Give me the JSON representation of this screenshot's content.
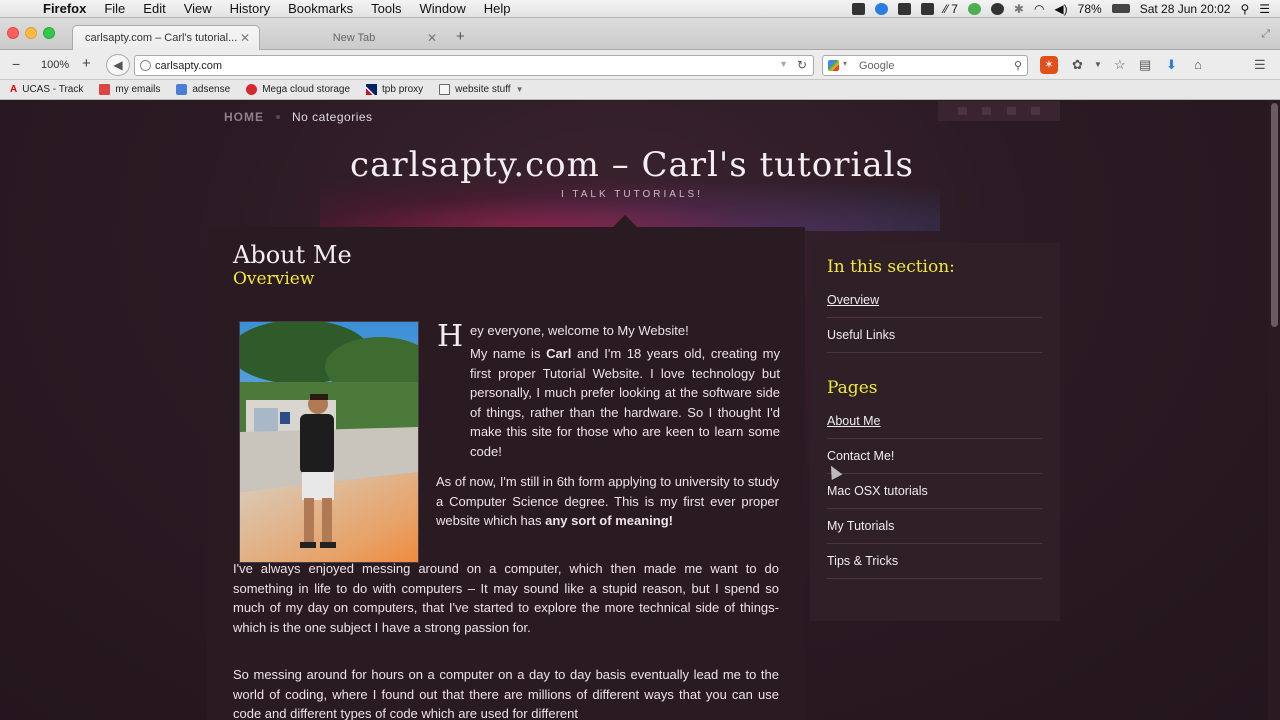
{
  "menubar": {
    "app": "Firefox",
    "items": [
      "File",
      "Edit",
      "View",
      "History",
      "Bookmarks",
      "Tools",
      "Window",
      "Help"
    ],
    "status_num": "7",
    "battery": "78%",
    "datetime": "Sat 28 Jun  20:02"
  },
  "browser": {
    "tabs": [
      {
        "label": "carlsapty.com – Carl's tutorial..."
      },
      {
        "label": "New Tab"
      }
    ],
    "zoom": "100%",
    "url": "carlsapty.com",
    "search_placeholder": "Google"
  },
  "bookmarks": [
    {
      "label": "UCAS - Track",
      "icon": "ucas-icon"
    },
    {
      "label": "my emails",
      "icon": "gmail-icon"
    },
    {
      "label": "adsense",
      "icon": "google-icon"
    },
    {
      "label": "Mega cloud storage",
      "icon": "mega-icon"
    },
    {
      "label": "tpb proxy",
      "icon": "flag-icon"
    },
    {
      "label": "website stuff",
      "icon": "folder-icon"
    }
  ],
  "site": {
    "nav_home": "HOME",
    "nav_categories": "No categories",
    "title": "carlsapty.com – Carl's tutorials",
    "tagline": "I TALK TUTORIALS!"
  },
  "article": {
    "heading": "About Me",
    "subheading": "Overview",
    "dropcap": "H",
    "p1": "ey everyone, welcome to My Website!",
    "p2_pre": "My name is ",
    "p2_bold": "Carl",
    "p2_post": " and I'm 18 years old, creating my first proper Tutorial Website. I love technology but personally, I much prefer looking at the software side of things, rather than the hardware. So I thought I'd make this site for those who are keen to learn some code!",
    "p3_pre": "As of now, I'm still in 6th form applying to university to study a Computer Science degree. This is my first ever proper website which has ",
    "p3_bold": "any sort of meaning!",
    "p4": "I've always enjoyed messing around on a computer, which then made me want to do something in life to do with computers – It may sound like a stupid reason, but I spend so much of my day on computers, that I've started to explore the more technical side of things- which is the one subject I have a strong passion for.",
    "p5": "So messing around for hours on a computer on a day to day basis eventually lead me to the world of coding, where I found out that there are millions of different ways that you can use code and different types of code which are used for different"
  },
  "sidebar": {
    "section_heading": "In this section:",
    "section_links": [
      "Overview",
      "Useful Links"
    ],
    "pages_heading": "Pages",
    "pages_links": [
      "About Me",
      "Contact Me!",
      "Mac OSX tutorials",
      "My Tutorials",
      "Tips & Tricks"
    ]
  },
  "colors": {
    "accent_yellow": "#f3e83c",
    "page_bg": "#2a1b22"
  }
}
